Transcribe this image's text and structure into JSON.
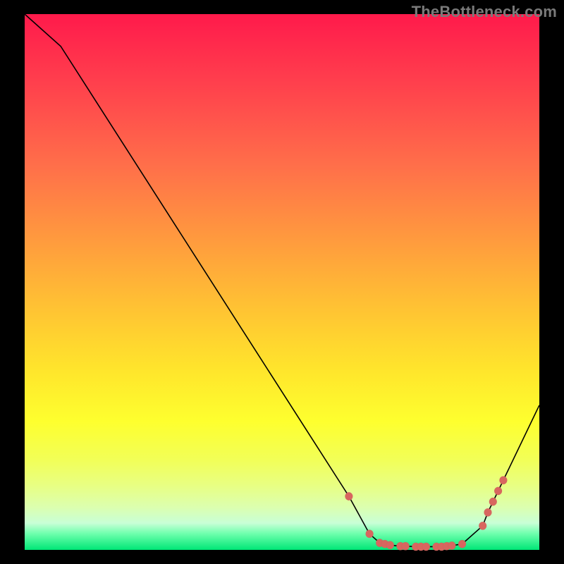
{
  "watermark": "TheBottleneck.com",
  "colors": {
    "line": "#000000",
    "marker": "#d8665f",
    "marker_stroke": "#b34d48",
    "gradient_top": "#ff1a4b",
    "gradient_bottom": "#00e676"
  },
  "chart_data": {
    "type": "line",
    "title": "",
    "xlabel": "",
    "ylabel": "",
    "xlim": [
      0,
      100
    ],
    "ylim": [
      0,
      100
    ],
    "series": [
      {
        "name": "bottleneck-curve",
        "x": [
          0,
          7,
          63,
          67,
          69,
          70,
          71,
          73,
          74,
          76,
          77,
          78,
          80,
          81,
          82,
          83,
          85,
          89,
          90,
          91,
          92,
          93,
          100
        ],
        "y": [
          100,
          94,
          10,
          3,
          1.3,
          1.1,
          0.9,
          0.7,
          0.7,
          0.6,
          0.6,
          0.6,
          0.6,
          0.6,
          0.7,
          0.8,
          1.1,
          4.5,
          7,
          9,
          11,
          13,
          27
        ]
      }
    ],
    "markers": {
      "name": "highlighted-range",
      "x": [
        63,
        67,
        69,
        70,
        71,
        73,
        74,
        76,
        77,
        78,
        80,
        81,
        82,
        83,
        85,
        89,
        90,
        91,
        92,
        93
      ],
      "y": [
        10,
        3,
        1.3,
        1.1,
        0.9,
        0.7,
        0.7,
        0.6,
        0.6,
        0.6,
        0.6,
        0.6,
        0.7,
        0.8,
        1.1,
        4.5,
        7,
        9,
        11,
        13
      ]
    }
  }
}
